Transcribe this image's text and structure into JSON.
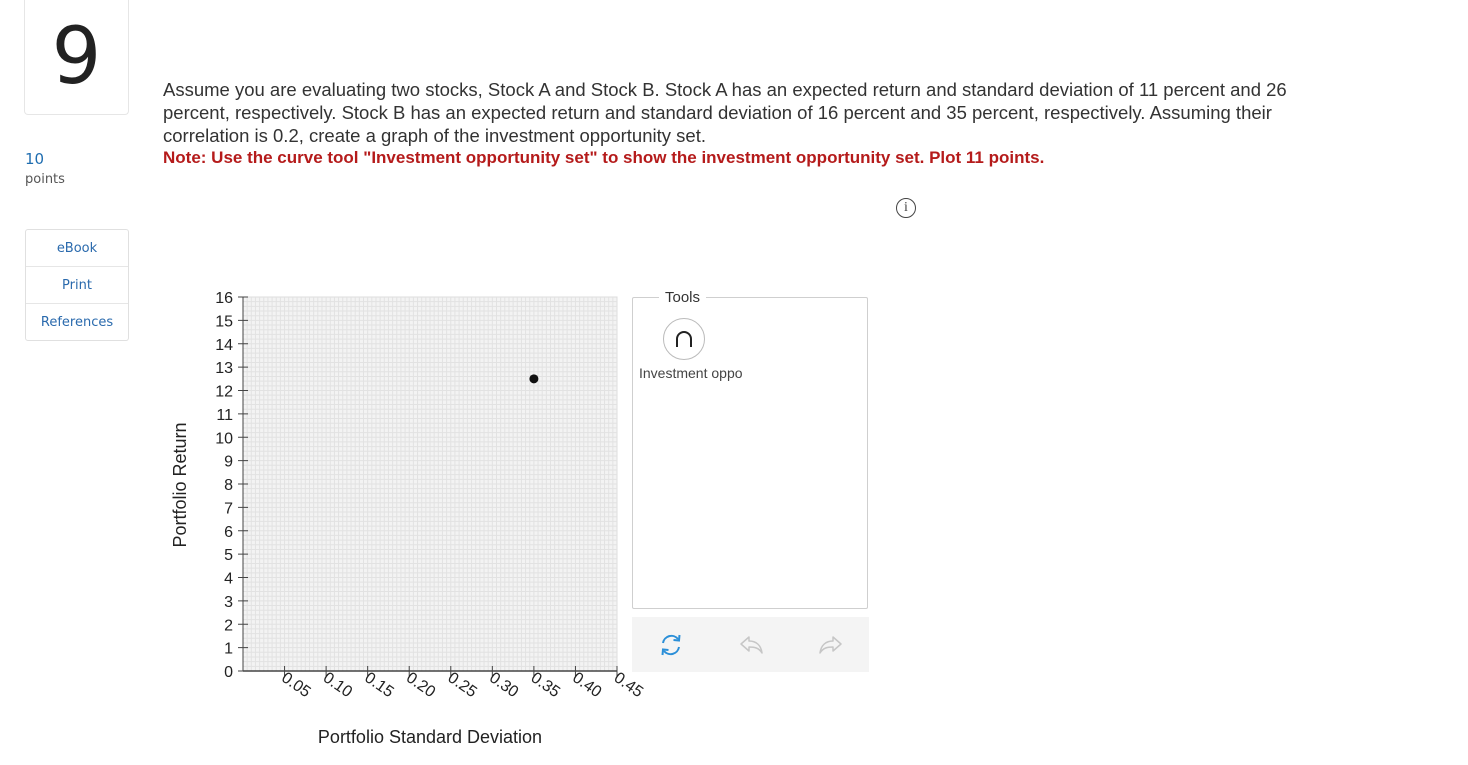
{
  "question": {
    "number": "9",
    "points_value": "10",
    "points_label": "points",
    "text": "Assume you are evaluating two stocks, Stock A and Stock B. Stock A has an expected return and standard deviation of 11 percent and 26 percent, respectively. Stock B has an expected return and standard deviation of 16 percent and 35 percent, respectively. Assuming their correlation is 0.2, create a graph of the investment opportunity set.",
    "note": "Note: Use the curve tool \"Investment opportunity set\" to show the investment opportunity set. Plot 11 points."
  },
  "sidebar": {
    "buttons": [
      "eBook",
      "Print",
      "References"
    ]
  },
  "tools": {
    "title": "Tools",
    "tool_label": "Investment opportunity set",
    "tool_icon": "arch-curve-icon",
    "actions": [
      "reset-icon",
      "undo-icon",
      "redo-icon"
    ]
  },
  "colors": {
    "note": "#b51b1b",
    "link": "#2a6aad",
    "reset_icon": "#2b8fd8"
  },
  "chart_data": {
    "type": "scatter",
    "xlabel": "Portfolio Standard Deviation",
    "ylabel": "Portfolio Return",
    "xlim": [
      0,
      0.45
    ],
    "ylim": [
      0,
      16
    ],
    "x_ticks": [
      "0.05",
      "0.10",
      "0.15",
      "0.20",
      "0.25",
      "0.30",
      "0.35",
      "0.40",
      "0.45"
    ],
    "y_ticks": [
      "0",
      "1",
      "2",
      "3",
      "4",
      "5",
      "6",
      "7",
      "8",
      "9",
      "10",
      "11",
      "12",
      "13",
      "14",
      "15",
      "16"
    ],
    "grid": true,
    "points": [
      {
        "x": 0.35,
        "y": 12.5
      }
    ]
  }
}
